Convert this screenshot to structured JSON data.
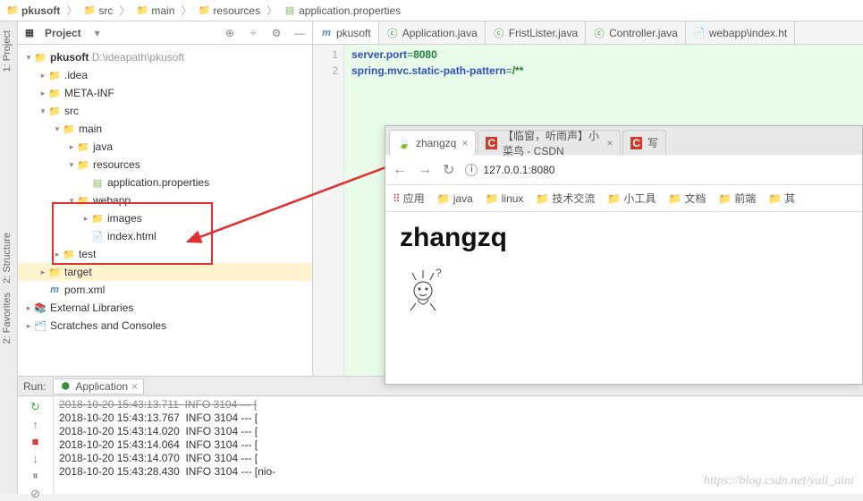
{
  "breadcrumb": [
    "pkusoft",
    "src",
    "main",
    "resources",
    "application.properties"
  ],
  "project_toolbar": {
    "title": "Project"
  },
  "sidebar_tabs": [
    "1: Project",
    "2: Favorites",
    "2: Structure"
  ],
  "tree": {
    "root": {
      "name": "pkusoft",
      "hint": "D:\\ideapath\\pkusoft"
    },
    "idea": ".idea",
    "meta": "META-INF",
    "src": "src",
    "main": "main",
    "java": "java",
    "resources": "resources",
    "appprops": "application.properties",
    "webapp": "webapp",
    "images": "images",
    "index": "index.html",
    "test": "test",
    "target": "target",
    "pom": "pom.xml",
    "extlib": "External Libraries",
    "scratches": "Scratches and Consoles"
  },
  "editor_tabs": [
    {
      "label": "pkusoft",
      "kind": "m"
    },
    {
      "label": "Application.java",
      "kind": "c"
    },
    {
      "label": "FristLister.java",
      "kind": "c"
    },
    {
      "label": "Controller.java",
      "kind": "c"
    },
    {
      "label": "webapp\\index.ht",
      "kind": "h"
    }
  ],
  "code": {
    "l1": {
      "k": "server.port",
      "v": "8080"
    },
    "l2": {
      "k": "spring.mvc.static-path-pattern",
      "v": "/**"
    }
  },
  "run": {
    "label": "Application",
    "title": "Run:"
  },
  "console_lines": [
    "2018-10-20 15:43:13.711  INFO 3104 --- [",
    "2018-10-20 15:43:13.767  INFO 3104 --- [",
    "2018-10-20 15:43:14.020  INFO 3104 --- [",
    "2018-10-20 15:43:14.064  INFO 3104 --- [",
    "2018-10-20 15:43:14.070  INFO 3104 --- [",
    "2018-10-20 15:43:28.430  INFO 3104 --- [nio-"
  ],
  "browser": {
    "tabs": [
      {
        "title": "zhangzq",
        "icon": "leaf"
      },
      {
        "title": "【临窗，听雨声】小菜鸟 - CSDN",
        "icon": "c"
      },
      {
        "title": "写",
        "icon": "c"
      }
    ],
    "url": "127.0.0.1:8080",
    "bookmarks": [
      "应用",
      "java",
      "linux",
      "技术交流",
      "小工具",
      "文档",
      "前端",
      "其"
    ],
    "page_heading": "zhangzq"
  },
  "watermark": "https://blog.csdn.net/yali_aini"
}
